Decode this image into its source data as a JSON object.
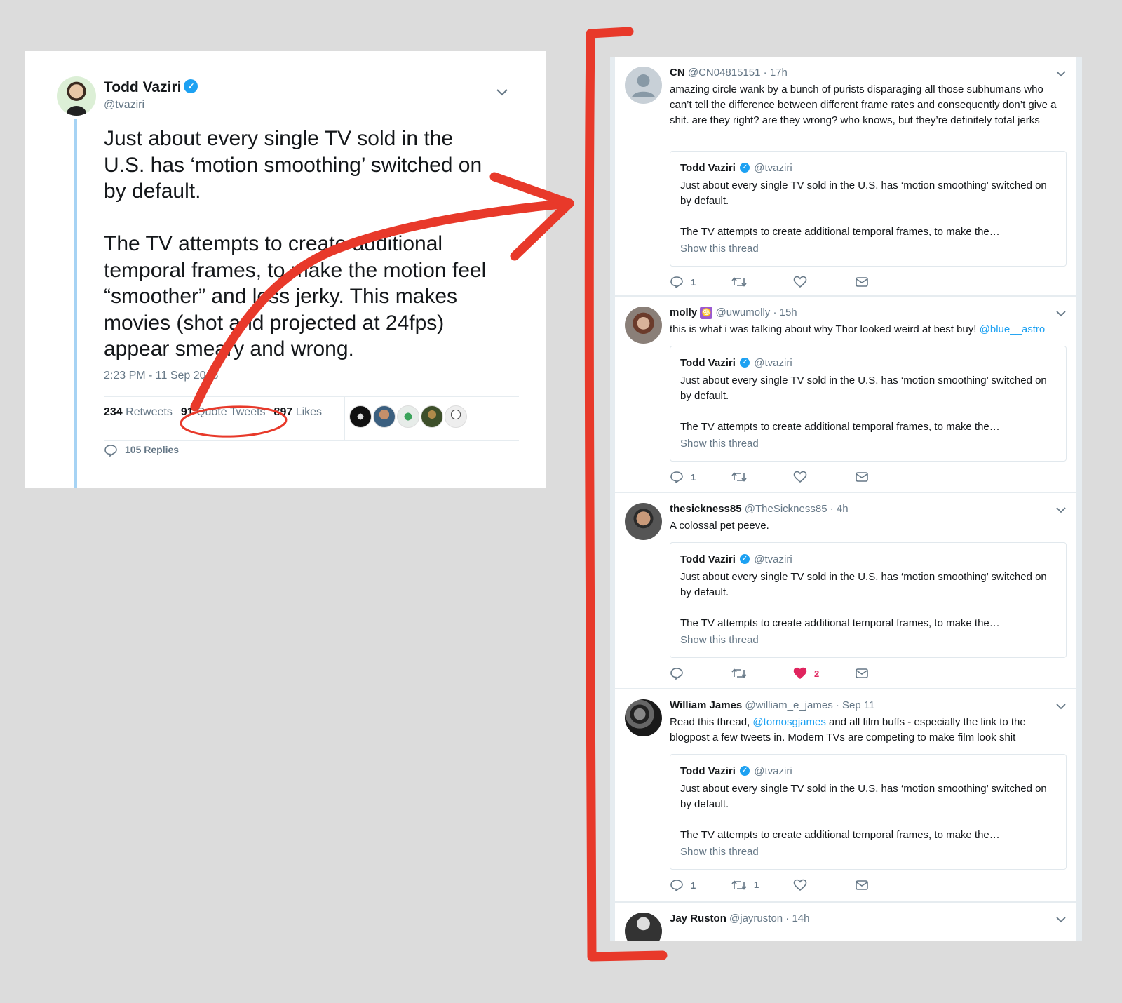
{
  "main_tweet": {
    "name": "Todd Vaziri",
    "handle": "@tvaziri",
    "text": "Just about every single TV sold in the U.S. has ‘motion smoothing’ switched on by default.\n\nThe TV attempts to create additional temporal frames, to make the motion feel “smoother” and less jerky. This makes movies (shot and projected at 24fps) appear smeary and wrong.",
    "timestamp": "2:23 PM - 11 Sep 2018",
    "retweets_count": "234",
    "retweets_label": "Retweets",
    "quote_count": "91",
    "quote_label": "Quote Tweets",
    "likes_count": "897",
    "likes_label": "Likes",
    "replies_label": "105 Replies"
  },
  "quote_tweets": [
    {
      "name": "CN",
      "handle": "@CN04815151",
      "time": "· 17h",
      "text": "amazing circle wank by a bunch of purists disparaging all those subhumans who can’t tell the difference between different frame rates and consequently don’t give a shit. are they right? are they wrong? who knows, but they’re definitely total jerks",
      "reply_count": "1",
      "retweet_count": "",
      "like_count": ""
    },
    {
      "name": "molly",
      "handle": "@uwumolly",
      "time": "· 15h",
      "text": "this is what i was talking about why Thor looked weird at best buy!",
      "mention": "@blue__astro",
      "reply_count": "1",
      "retweet_count": "",
      "like_count": ""
    },
    {
      "name": "thesickness85",
      "handle": "@TheSickness85",
      "time": "· 4h",
      "text": "A colossal pet peeve.",
      "reply_count": "",
      "retweet_count": "",
      "like_count": "2"
    },
    {
      "name": "William James",
      "handle": "@william_e_james",
      "time": "· Sep 11",
      "text_before": "Read this thread,",
      "mention": "@tomosgjames",
      "text_after": "and all film buffs - especially the link to the blogpost a few tweets in. Modern TVs are competing to make film look shit",
      "reply_count": "1",
      "retweet_count": "1",
      "like_count": ""
    },
    {
      "name": "Jay Ruston",
      "handle": "@jayruston",
      "time": "· 14h"
    }
  ],
  "quoted_tweet": {
    "name": "Todd Vaziri",
    "handle": "@tvaziri",
    "text": "Just about every single TV sold in the U.S. has ‘motion smoothing’ switched on by default.\n\nThe TV attempts to create additional temporal frames, to make the…",
    "show_thread": "Show this thread"
  },
  "colors": {
    "background": "#dcdcdc",
    "annotation_red": "#e8392a",
    "link_blue": "#1da1f2",
    "like_red": "#e0245e",
    "thread_line": "#a6d3f4"
  },
  "icons": [
    "verified-icon",
    "chevron-down-icon",
    "reply-icon",
    "retweet-icon",
    "like-icon",
    "dm-icon"
  ]
}
